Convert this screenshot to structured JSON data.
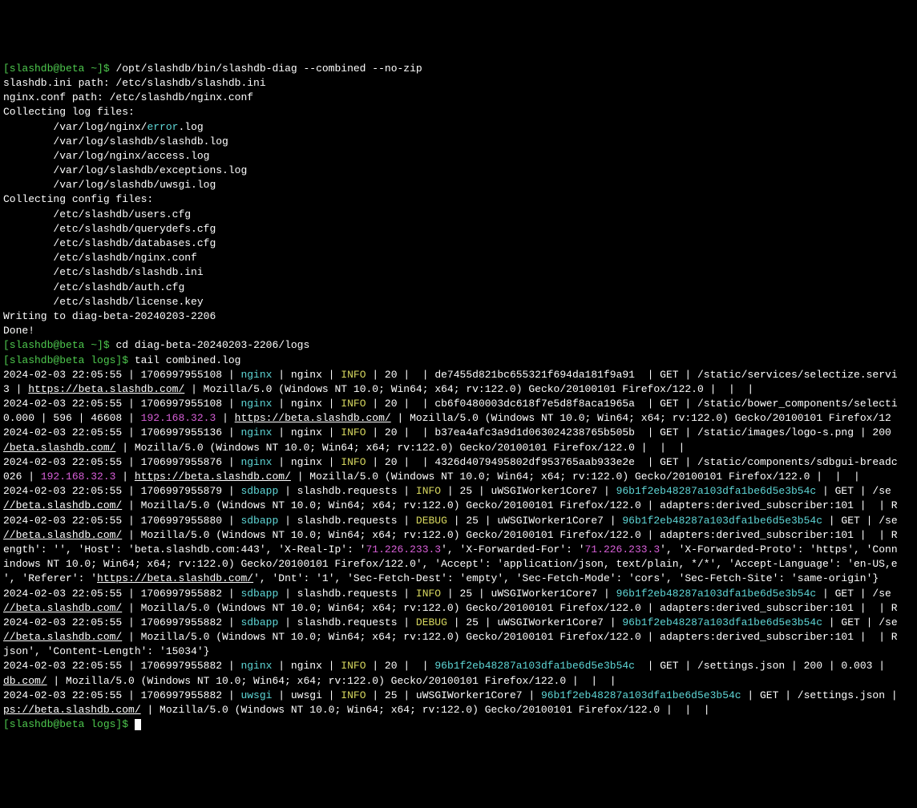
{
  "lines": [
    {
      "segments": [
        {
          "text": "[slashdb@beta ~]$ ",
          "class": "green"
        },
        {
          "text": "/opt/slashdb/bin/slashdb-diag --combined --no-zip",
          "class": "white"
        }
      ]
    },
    {
      "segments": [
        {
          "text": "slashdb.ini path: /etc/slashdb/slashdb.ini",
          "class": "white"
        }
      ]
    },
    {
      "segments": [
        {
          "text": "nginx.conf path: /etc/slashdb/nginx.conf",
          "class": "white"
        }
      ]
    },
    {
      "segments": [
        {
          "text": "Collecting log files:",
          "class": "white"
        }
      ]
    },
    {
      "segments": [
        {
          "text": "        /var/log/nginx/",
          "class": "white"
        },
        {
          "text": "error",
          "class": "cyan"
        },
        {
          "text": ".log",
          "class": "white"
        }
      ]
    },
    {
      "segments": [
        {
          "text": "        /var/log/slashdb/slashdb.log",
          "class": "white"
        }
      ]
    },
    {
      "segments": [
        {
          "text": "        /var/log/nginx/access.log",
          "class": "white"
        }
      ]
    },
    {
      "segments": [
        {
          "text": "        /var/log/slashdb/exceptions.log",
          "class": "white"
        }
      ]
    },
    {
      "segments": [
        {
          "text": "        /var/log/slashdb/uwsgi.log",
          "class": "white"
        }
      ]
    },
    {
      "segments": [
        {
          "text": "Collecting config files:",
          "class": "white"
        }
      ]
    },
    {
      "segments": [
        {
          "text": "        /etc/slashdb/users.cfg",
          "class": "white"
        }
      ]
    },
    {
      "segments": [
        {
          "text": "        /etc/slashdb/querydefs.cfg",
          "class": "white"
        }
      ]
    },
    {
      "segments": [
        {
          "text": "        /etc/slashdb/databases.cfg",
          "class": "white"
        }
      ]
    },
    {
      "segments": [
        {
          "text": "        /etc/slashdb/nginx.conf",
          "class": "white"
        }
      ]
    },
    {
      "segments": [
        {
          "text": "        /etc/slashdb/slashdb.ini",
          "class": "white"
        }
      ]
    },
    {
      "segments": [
        {
          "text": "        /etc/slashdb/auth.cfg",
          "class": "white"
        }
      ]
    },
    {
      "segments": [
        {
          "text": "        /etc/slashdb/license.key",
          "class": "white"
        }
      ]
    },
    {
      "segments": [
        {
          "text": "Writing to diag-beta-20240203-2206",
          "class": "white"
        }
      ]
    },
    {
      "segments": [
        {
          "text": "Done!",
          "class": "white"
        }
      ]
    },
    {
      "segments": [
        {
          "text": "[slashdb@beta ~]$ ",
          "class": "green"
        },
        {
          "text": "cd diag-beta-20240203-2206/logs",
          "class": "white"
        }
      ]
    },
    {
      "segments": [
        {
          "text": "[slashdb@beta logs]$ ",
          "class": "green"
        },
        {
          "text": "tail combined.log",
          "class": "white"
        }
      ]
    },
    {
      "segments": [
        {
          "text": "2024-02-03 22:05:55 | 1706997955108 | ",
          "class": "white"
        },
        {
          "text": "nginx",
          "class": "cyan"
        },
        {
          "text": " | nginx | ",
          "class": "white"
        },
        {
          "text": "INFO",
          "class": "yellow"
        },
        {
          "text": " | 20 |  | de7455d821bc655321f694da181f9a91  | GET | /static/services/selectize.servi",
          "class": "white"
        }
      ]
    },
    {
      "segments": [
        {
          "text": "3 | ",
          "class": "white"
        },
        {
          "text": "https://beta.slashdb.com/",
          "class": "link"
        },
        {
          "text": " | Mozilla/5.0 (Windows NT 10.0; Win64; x64; rv:122.0) Gecko/20100101 Firefox/122.0 |  |  |",
          "class": "white"
        }
      ]
    },
    {
      "segments": [
        {
          "text": "2024-02-03 22:05:55 | 1706997955108 | ",
          "class": "white"
        },
        {
          "text": "nginx",
          "class": "cyan"
        },
        {
          "text": " | nginx | ",
          "class": "white"
        },
        {
          "text": "INFO",
          "class": "yellow"
        },
        {
          "text": " | 20 |  | cb6f0480003dc618f7e5d8f8aca1965a  | GET | /static/bower_components/selecti",
          "class": "white"
        }
      ]
    },
    {
      "segments": [
        {
          "text": "0.000 | 596 | 46608 | ",
          "class": "white"
        },
        {
          "text": "192.168.32.3",
          "class": "magenta"
        },
        {
          "text": " | ",
          "class": "white"
        },
        {
          "text": "https://beta.slashdb.com/",
          "class": "link"
        },
        {
          "text": " | Mozilla/5.0 (Windows NT 10.0; Win64; x64; rv:122.0) Gecko/20100101 Firefox/12",
          "class": "white"
        }
      ]
    },
    {
      "segments": [
        {
          "text": "2024-02-03 22:05:55 | 1706997955136 | ",
          "class": "white"
        },
        {
          "text": "nginx",
          "class": "cyan"
        },
        {
          "text": " | nginx | ",
          "class": "white"
        },
        {
          "text": "INFO",
          "class": "yellow"
        },
        {
          "text": " | 20 |  | b37ea4afc3a9d1d063024238765b505b  | GET | /static/images/logo-s.png | 200 ",
          "class": "white"
        }
      ]
    },
    {
      "segments": [
        {
          "text": "/beta.slashdb.com/",
          "class": "link"
        },
        {
          "text": " | Mozilla/5.0 (Windows NT 10.0; Win64; x64; rv:122.0) Gecko/20100101 Firefox/122.0 |  |  |",
          "class": "white"
        }
      ]
    },
    {
      "segments": [
        {
          "text": "2024-02-03 22:05:55 | 1706997955876 | ",
          "class": "white"
        },
        {
          "text": "nginx",
          "class": "cyan"
        },
        {
          "text": " | nginx | ",
          "class": "white"
        },
        {
          "text": "INFO",
          "class": "yellow"
        },
        {
          "text": " | 20 |  | 4326d4079495802df953765aab933e2e  | GET | /static/components/sdbgui-breadc",
          "class": "white"
        }
      ]
    },
    {
      "segments": [
        {
          "text": "026 | ",
          "class": "white"
        },
        {
          "text": "192.168.32.3",
          "class": "magenta"
        },
        {
          "text": " | ",
          "class": "white"
        },
        {
          "text": "https://beta.slashdb.com/",
          "class": "link"
        },
        {
          "text": " | Mozilla/5.0 (Windows NT 10.0; Win64; x64; rv:122.0) Gecko/20100101 Firefox/122.0 |  |  |",
          "class": "white"
        }
      ]
    },
    {
      "segments": [
        {
          "text": "2024-02-03 22:05:55 | 1706997955879 | ",
          "class": "white"
        },
        {
          "text": "sdbapp",
          "class": "cyan"
        },
        {
          "text": " | slashdb.requests | ",
          "class": "white"
        },
        {
          "text": "INFO",
          "class": "yellow"
        },
        {
          "text": " | 25 | uWSGIWorker1Core7 | ",
          "class": "white"
        },
        {
          "text": "96b1f2eb48287a103dfa1be6d5e3b54c",
          "class": "cyan"
        },
        {
          "text": " | GET | /se",
          "class": "white"
        }
      ]
    },
    {
      "segments": [
        {
          "text": "//beta.slashdb.com/",
          "class": "link"
        },
        {
          "text": " | Mozilla/5.0 (Windows NT 10.0; Win64; x64; rv:122.0) Gecko/20100101 Firefox/122.0 | adapters:derived_subscriber:101 |  | R",
          "class": "white"
        }
      ]
    },
    {
      "segments": [
        {
          "text": "2024-02-03 22:05:55 | 1706997955880 | ",
          "class": "white"
        },
        {
          "text": "sdbapp",
          "class": "cyan"
        },
        {
          "text": " | slashdb.requests | ",
          "class": "white"
        },
        {
          "text": "DEBUG",
          "class": "yellow"
        },
        {
          "text": " | 25 | uWSGIWorker1Core7 | ",
          "class": "white"
        },
        {
          "text": "96b1f2eb48287a103dfa1be6d5e3b54c",
          "class": "cyan"
        },
        {
          "text": " | GET | /se",
          "class": "white"
        }
      ]
    },
    {
      "segments": [
        {
          "text": "//beta.slashdb.com/",
          "class": "link"
        },
        {
          "text": " | Mozilla/5.0 (Windows NT 10.0; Win64; x64; rv:122.0) Gecko/20100101 Firefox/122.0 | adapters:derived_subscriber:101 |  | R",
          "class": "white"
        }
      ]
    },
    {
      "segments": [
        {
          "text": "ength': '', 'Host': 'beta.slashdb.com:443', 'X-Real-Ip': '",
          "class": "white"
        },
        {
          "text": "71.226.233.3",
          "class": "magenta"
        },
        {
          "text": "', 'X-Forwarded-For': '",
          "class": "white"
        },
        {
          "text": "71.226.233.3",
          "class": "magenta"
        },
        {
          "text": "', 'X-Forwarded-Proto': 'https', 'Conn",
          "class": "white"
        }
      ]
    },
    {
      "segments": [
        {
          "text": "indows NT 10.0; Win64; x64; rv:122.0) Gecko/20100101 Firefox/122.0', 'Accept': 'application/json, text/plain, */*', 'Accept-Language': 'en-US,e",
          "class": "white"
        }
      ]
    },
    {
      "segments": [
        {
          "text": "', 'Referer': '",
          "class": "white"
        },
        {
          "text": "https://beta.slashdb.com/",
          "class": "link"
        },
        {
          "text": "', 'Dnt': '1', 'Sec-Fetch-Dest': 'empty', 'Sec-Fetch-Mode': 'cors', 'Sec-Fetch-Site': 'same-origin'}",
          "class": "white"
        }
      ]
    },
    {
      "segments": [
        {
          "text": "2024-02-03 22:05:55 | 1706997955882 | ",
          "class": "white"
        },
        {
          "text": "sdbapp",
          "class": "cyan"
        },
        {
          "text": " | slashdb.requests | ",
          "class": "white"
        },
        {
          "text": "INFO",
          "class": "yellow"
        },
        {
          "text": " | 25 | uWSGIWorker1Core7 | ",
          "class": "white"
        },
        {
          "text": "96b1f2eb48287a103dfa1be6d5e3b54c",
          "class": "cyan"
        },
        {
          "text": " | GET | /se",
          "class": "white"
        }
      ]
    },
    {
      "segments": [
        {
          "text": "//beta.slashdb.com/",
          "class": "link"
        },
        {
          "text": " | Mozilla/5.0 (Windows NT 10.0; Win64; x64; rv:122.0) Gecko/20100101 Firefox/122.0 | adapters:derived_subscriber:101 |  | R",
          "class": "white"
        }
      ]
    },
    {
      "segments": [
        {
          "text": "2024-02-03 22:05:55 | 1706997955882 | ",
          "class": "white"
        },
        {
          "text": "sdbapp",
          "class": "cyan"
        },
        {
          "text": " | slashdb.requests | ",
          "class": "white"
        },
        {
          "text": "DEBUG",
          "class": "yellow"
        },
        {
          "text": " | 25 | uWSGIWorker1Core7 | ",
          "class": "white"
        },
        {
          "text": "96b1f2eb48287a103dfa1be6d5e3b54c",
          "class": "cyan"
        },
        {
          "text": " | GET | /se",
          "class": "white"
        }
      ]
    },
    {
      "segments": [
        {
          "text": "//beta.slashdb.com/",
          "class": "link"
        },
        {
          "text": " | Mozilla/5.0 (Windows NT 10.0; Win64; x64; rv:122.0) Gecko/20100101 Firefox/122.0 | adapters:derived_subscriber:101 |  | R",
          "class": "white"
        }
      ]
    },
    {
      "segments": [
        {
          "text": "json', 'Content-Length': '15034'}",
          "class": "white"
        }
      ]
    },
    {
      "segments": [
        {
          "text": "2024-02-03 22:05:55 | 1706997955882 | ",
          "class": "white"
        },
        {
          "text": "nginx",
          "class": "cyan"
        },
        {
          "text": " | nginx | ",
          "class": "white"
        },
        {
          "text": "INFO",
          "class": "yellow"
        },
        {
          "text": " | 20 |  | ",
          "class": "white"
        },
        {
          "text": "96b1f2eb48287a103dfa1be6d5e3b54c",
          "class": "cyan"
        },
        {
          "text": "  | GET | /settings.json | 200 | 0.003 | ",
          "class": "white"
        }
      ]
    },
    {
      "segments": [
        {
          "text": "db.com/",
          "class": "link"
        },
        {
          "text": " | Mozilla/5.0 (Windows NT 10.0; Win64; x64; rv:122.0) Gecko/20100101 Firefox/122.0 |  |  |",
          "class": "white"
        }
      ]
    },
    {
      "segments": [
        {
          "text": "2024-02-03 22:05:55 | 1706997955882 | ",
          "class": "white"
        },
        {
          "text": "uwsgi",
          "class": "cyan"
        },
        {
          "text": " | uwsgi | ",
          "class": "white"
        },
        {
          "text": "INFO",
          "class": "yellow"
        },
        {
          "text": " | 25 | uWSGIWorker1Core7 | ",
          "class": "white"
        },
        {
          "text": "96b1f2eb48287a103dfa1be6d5e3b54c",
          "class": "cyan"
        },
        {
          "text": " | GET | /settings.json | ",
          "class": "white"
        }
      ]
    },
    {
      "segments": [
        {
          "text": "ps://beta.slashdb.com/",
          "class": "link"
        },
        {
          "text": " | Mozilla/5.0 (Windows NT 10.0; Win64; x64; rv:122.0) Gecko/20100101 Firefox/122.0 |  |  |",
          "class": "white"
        }
      ]
    },
    {
      "segments": [
        {
          "text": "[slashdb@beta logs]$ ",
          "class": "green"
        }
      ],
      "cursor": true
    }
  ]
}
